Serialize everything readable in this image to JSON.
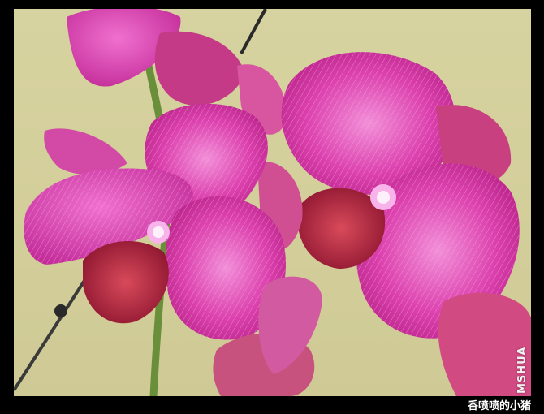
{
  "photo": {
    "subject_icon": "orchid-flowers-photo",
    "colors": {
      "frame": "#000000",
      "background": "#d9d5a4",
      "petal": "#d83aa6",
      "petal_light": "#f07ad0",
      "lip": "#b0213a",
      "stem": "#6a8f3a"
    }
  },
  "watermark": {
    "vertical_text": "MSHUA"
  },
  "caption": {
    "text": "香喷喷的小猪"
  }
}
